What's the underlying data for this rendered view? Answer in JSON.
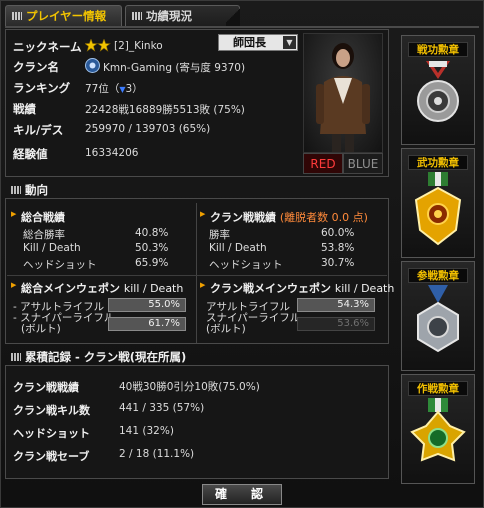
{
  "tabs": [
    {
      "label": "プレイヤー情報"
    },
    {
      "label": "功績現況"
    }
  ],
  "profile": {
    "nickname_label": "ニックネーム",
    "nickname": "[2]_Kinko",
    "rank_title": "師団長",
    "clan_label": "クラン名",
    "clan": "Kmn-Gaming (寄与度 9370)",
    "ranking_label": "ランキング",
    "ranking": "77位（",
    "ranking_change": "3",
    "ranking_close": "）",
    "record_label": "戦績",
    "record": "22428戦16889勝5513敗 (75%)",
    "kd_label": "キル/デス",
    "kd": "259970 / 139703 (65%)",
    "exp_label": "経験値",
    "exp": "16334206",
    "team_red": "RED",
    "team_blue": "BLUE"
  },
  "trend": {
    "title": "動向",
    "overall": {
      "title": "総合戦績",
      "rows": [
        {
          "label": "総合勝率",
          "value": "40.8%"
        },
        {
          "label": "Kill / Death",
          "value": "50.3%"
        },
        {
          "label": "ヘッドショット",
          "value": "65.9%"
        }
      ]
    },
    "clan": {
      "title": "クラン戦戦績",
      "note": "(離脱者数  0.0 点)",
      "rows": [
        {
          "label": "勝率",
          "value": "60.0%"
        },
        {
          "label": "Kill / Death",
          "value": "53.8%"
        },
        {
          "label": "ヘッドショット",
          "value": "30.7%"
        }
      ]
    },
    "overall_weapon": {
      "title": "総合メインウェポン",
      "metric": "kill / Death",
      "rows": [
        {
          "label": "- アサルトライフル",
          "value": "55.0%",
          "label2": ""
        },
        {
          "label": "- スナイパーライフル",
          "label2": "(ボルト)",
          "value": "61.7%"
        }
      ]
    },
    "clan_weapon": {
      "title": "クラン戦メインウェポン",
      "metric": "kill / Death",
      "rows": [
        {
          "label": "アサルトライフル",
          "value": "54.3%",
          "label2": ""
        },
        {
          "label": "スナイパーライフル",
          "label2": "(ボルト)",
          "value": "53.6%"
        }
      ]
    }
  },
  "cumulative": {
    "title": "累積記録 - クラン戦(現在所属)",
    "rows": [
      {
        "label": "クラン戦戦績",
        "value": "40戦30勝0引分10敗(75.0%)"
      },
      {
        "label": "クラン戦キル数",
        "value": "441 / 335 (57%)"
      },
      {
        "label": "ヘッドショット",
        "value": "141 (32%)"
      },
      {
        "label": "クラン戦セーブ",
        "value": "2 / 18 (11.1%)"
      }
    ]
  },
  "medals": [
    {
      "label": "戦功勲章"
    },
    {
      "label": "武功勲章"
    },
    {
      "label": "参戦勲章"
    },
    {
      "label": "作戦勲章"
    }
  ],
  "confirm_label": "確　認",
  "colors": {
    "accent": "#f2c400",
    "red_team": "#ff3b3b",
    "note": "#ff8a3a"
  }
}
